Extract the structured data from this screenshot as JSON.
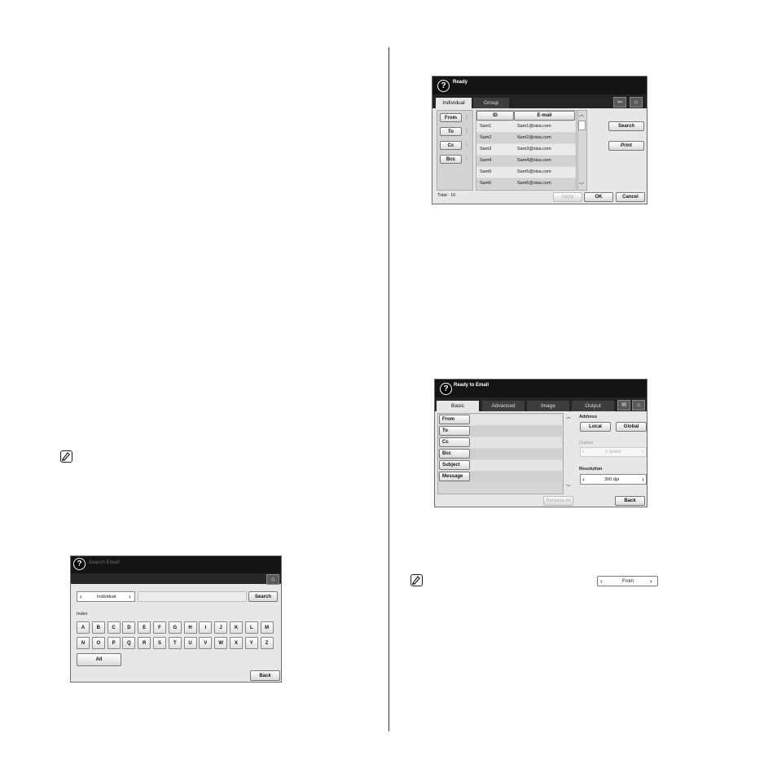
{
  "address_book": {
    "title": "Ready",
    "tabs": [
      "Individual",
      "Group"
    ],
    "recipient_buttons": [
      "From",
      "To",
      "Cc",
      "Bcc"
    ],
    "columns": [
      "ID",
      "E-mail"
    ],
    "rows": [
      {
        "id": "Sam1",
        "email": "Sam1@sisa.com"
      },
      {
        "id": "Sam2",
        "email": "Sam2@sisa.com"
      },
      {
        "id": "Sam3",
        "email": "Sam3@sisa.com"
      },
      {
        "id": "Sam4",
        "email": "Sam4@sisa.com"
      },
      {
        "id": "Sam5",
        "email": "Sam5@sisa.com"
      },
      {
        "id": "Sam6",
        "email": "Sam6@sisa.com"
      }
    ],
    "search_label": "Search",
    "print_label": "Print",
    "total": "Total : 10",
    "apply_label": "Apply",
    "ok_label": "OK",
    "cancel_label": "Cancel"
  },
  "email_screen": {
    "title": "Ready to Email",
    "tabs": [
      "Basic",
      "Advanced",
      "Image",
      "Output"
    ],
    "fields": [
      "From",
      "To",
      "Cc",
      "Bcc",
      "Subject",
      "Message"
    ],
    "remove_all_label": "Remove All",
    "address_label": "Address",
    "local_label": "Local",
    "global_label": "Global",
    "duplex_label": "Duplex",
    "duplex_value": "1-Sided",
    "resolution_label": "Resolution",
    "resolution_value": "300 dpi",
    "back_label": "Back"
  },
  "search_screen": {
    "title": "Search Email",
    "selector_value": "Individual",
    "search_label": "Search",
    "index_label": "Index",
    "keys_row1": [
      "A",
      "B",
      "C",
      "D",
      "E",
      "F",
      "G",
      "H",
      "I",
      "J",
      "K",
      "L",
      "M"
    ],
    "keys_row2": [
      "N",
      "O",
      "P",
      "Q",
      "R",
      "S",
      "T",
      "U",
      "V",
      "W",
      "X",
      "Y",
      "Z"
    ],
    "all_label": "All",
    "back_label": "Back"
  },
  "note_widget": {
    "value": "From"
  }
}
